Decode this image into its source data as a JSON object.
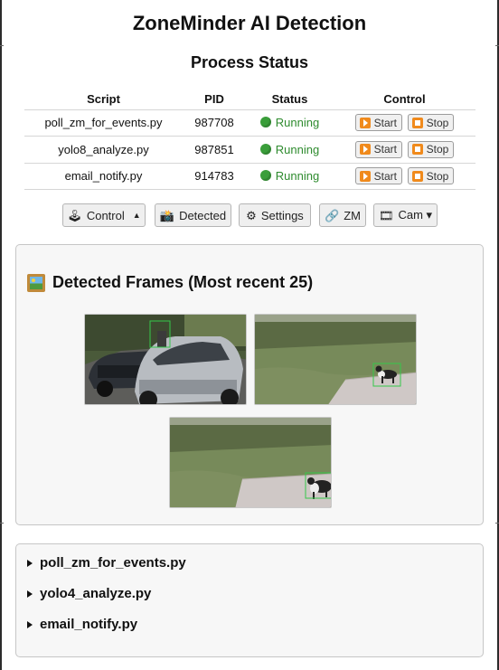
{
  "app_title": "ZoneMinder AI Detection",
  "process_status": {
    "heading": "Process Status",
    "columns": [
      "Script",
      "PID",
      "Status",
      "Control"
    ],
    "rows": [
      {
        "script": "poll_zm_for_events.py",
        "pid": "987708",
        "status": "Running"
      },
      {
        "script": "yolo8_analyze.py",
        "pid": "987851",
        "status": "Running"
      },
      {
        "script": "email_notify.py",
        "pid": "914783",
        "status": "Running"
      }
    ],
    "start_label": "Start",
    "stop_label": "Stop",
    "status_color": "#2e8b2e"
  },
  "navbar": {
    "control": "Control",
    "detected": "Detected",
    "settings": "Settings",
    "zm": "ZM",
    "cam": "Cam ▾"
  },
  "detected_frames": {
    "title": "Detected Frames (Most recent 25)",
    "frames": [
      {
        "scene": "driveway-cars",
        "detection": "person"
      },
      {
        "scene": "yard-dog",
        "detection": "dog"
      },
      {
        "scene": "yard-dog",
        "detection": "dog"
      }
    ]
  },
  "logs": {
    "items": [
      "poll_zm_for_events.py",
      "yolo4_analyze.py",
      "email_notify.py"
    ]
  },
  "colors": {
    "accent_orange": "#f08a1c",
    "running_green": "#3a9e3a",
    "detection_box": "#35c84a"
  }
}
